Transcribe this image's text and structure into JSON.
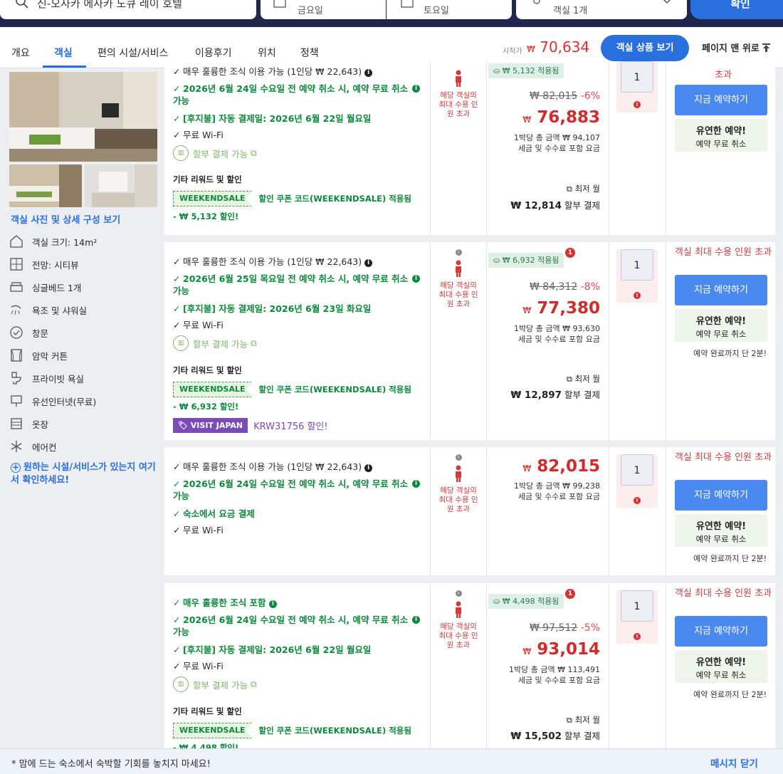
{
  "search": {
    "hotel_value": "신-오사카 에사카 도큐 레이 호텔",
    "checkin": "금요일",
    "checkout": "토요일",
    "rooms": "객실 1개",
    "confirm": "확인"
  },
  "tabs": [
    {
      "label": "개요"
    },
    {
      "label": "객실"
    },
    {
      "label": "편의 시설/서비스"
    },
    {
      "label": "이용후기"
    },
    {
      "label": "위치"
    },
    {
      "label": "정책"
    }
  ],
  "header": {
    "from_label": "시작가",
    "from_currency": "₩",
    "from_price": "70,634",
    "view_rooms": "객실 상품 보기",
    "to_top": "페이지 맨 위로"
  },
  "sidebar": {
    "view_photos": "객실 사진 및 상세 구성 보기",
    "amenities": [
      {
        "icon": "room-size-icon",
        "label": "객실 크기: 14m²"
      },
      {
        "icon": "view-icon",
        "label": "전망: 시티뷰"
      },
      {
        "icon": "bed-icon",
        "label": "싱글베드 1개"
      },
      {
        "icon": "shower-icon",
        "label": "욕조 및 샤워실"
      },
      {
        "icon": "window-icon",
        "label": "창문"
      },
      {
        "icon": "curtain-icon",
        "label": "암막 커튼"
      },
      {
        "icon": "toilet-icon",
        "label": "프라이빗 욕실"
      },
      {
        "icon": "wifi-icon",
        "label": "유선인터넷(무료)"
      },
      {
        "icon": "closet-icon",
        "label": "옷장"
      },
      {
        "icon": "snowflake-icon",
        "label": "에어컨"
      }
    ],
    "find_link": "원하는 시설/서비스가 있는지 여기서 확인하세요!"
  },
  "common": {
    "other_rewards": "기타 리워드 및 할인",
    "coupon_code": "WEEKENDSALE",
    "coupon_text": "할인 쿠폰 코드(WEEKENDSALE) 적용됨",
    "pay_later": "할부 결제 가능",
    "occupancy_exceeded": "해당 객실의 최대 수용 인원 초과",
    "book_now": "지금 예약하기",
    "flex_title": "유연한 예약!",
    "flex_sub": "예약 무료 취소",
    "max_exceeded": "객실 최대 수용 인원 초과",
    "hurry": "예약 완료까지 단 2분!",
    "min_label": "최저 월",
    "inst_suffix": "할부 결제",
    "per_night_label": "1박당 총 금액",
    "taxes": "세금 및 수수료 포함 요금",
    "currency": "₩"
  },
  "rooms": [
    {
      "features": [
        {
          "text": "매우 훌륭한 조식 이용 가능 (1인당 ₩ 22,643)",
          "green": false,
          "info": "b"
        },
        {
          "text": "2026년 6월 24일 수요일 전 예약 취소 시, 예약 무료 취소 가능",
          "green": true,
          "info": "g"
        },
        {
          "text": "[후지불] 자동 결제일: 2026년 6월 22일 월요일",
          "green": true
        },
        {
          "text": "무료 Wi-Fi",
          "green": false
        }
      ],
      "discount": "- ₩ 5,132 할인!",
      "badge": "₩ 5,132 적용됨",
      "orig_price": "₩ 82,015",
      "pct": "-6%",
      "price": "76,883",
      "per_night": "1박당 총 금액 ₩ 94,107",
      "installment": "₩ 12,814",
      "qty": "1"
    },
    {
      "features": [
        {
          "text": "매우 훌륭한 조식 이용 가능 (1인당 ₩ 22,643)",
          "green": false,
          "info": "b"
        },
        {
          "text": "2026년 6월 25일 목요일 전 예약 취소 시, 예약 무료 취소 가능",
          "green": true,
          "info": "g"
        },
        {
          "text": "[후지불] 자동 결제일: 2026년 6월 23일 화요일",
          "green": true
        },
        {
          "text": "무료 Wi-Fi",
          "green": false
        }
      ],
      "discount": "- ₩ 6,932 할인!",
      "visit_japan": "VISIT JAPAN",
      "visit_discount": "KRW31756 할인!",
      "badge": "₩ 6,932 적용됨",
      "badge_count": "1",
      "orig_price": "₩ 84,312",
      "pct": "-8%",
      "price": "77,380",
      "per_night": "1박당 총 금액 ₩ 93,630",
      "installment": "₩ 12,897",
      "qty": "1"
    },
    {
      "features": [
        {
          "text": "매우 훌륭한 조식 이용 가능 (1인당 ₩ 22,643)",
          "green": false,
          "info": "b"
        },
        {
          "text": "2026년 6월 24일 수요일 전 예약 취소 시, 예약 무료 취소 가능",
          "green": true,
          "info": "g"
        },
        {
          "text": "숙소에서 요금 결제",
          "green": true
        },
        {
          "text": "무료 Wi-Fi",
          "green": false
        }
      ],
      "price": "82,015",
      "per_night": "1박당 총 금액 ₩ 99,238",
      "qty": "1"
    },
    {
      "features": [
        {
          "text": "매우 훌륭한 조식 포함",
          "green": true,
          "info": "g"
        },
        {
          "text": "2026년 6월 24일 수요일 전 예약 취소 시, 예약 무료 취소 가능",
          "green": true,
          "info": "g"
        },
        {
          "text": "[후지불] 자동 결제일: 2026년 6월 22일 월요일",
          "green": true
        },
        {
          "text": "무료 Wi-Fi",
          "green": false
        }
      ],
      "discount": "- ₩ 4,498 할인!",
      "badge": "₩ 4,498 적용됨",
      "badge_count": "1",
      "orig_price": "₩ 97,512",
      "pct": "-5%",
      "price": "93,014",
      "per_night": "1박당 총 금액 ₩ 113,491",
      "installment": "₩ 15,502",
      "qty": "1"
    }
  ],
  "footer": {
    "message": "* 맘에 드는 숙소에서 숙박할 기회를 놓치지 마세요!",
    "close": "메시지 닫기"
  }
}
